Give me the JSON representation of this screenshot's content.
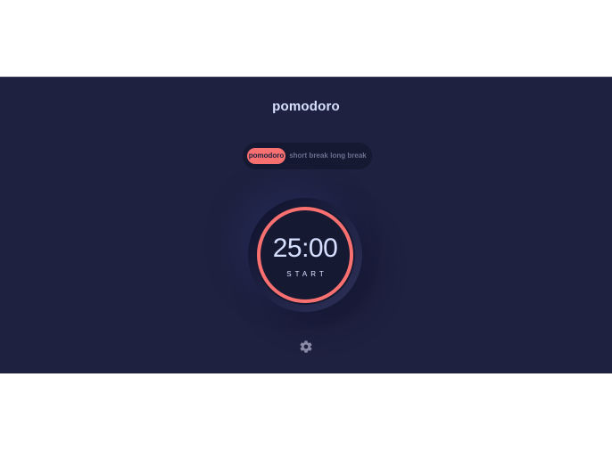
{
  "app": {
    "title": "pomodoro"
  },
  "modes": [
    {
      "label": "pomodoro",
      "active": true
    },
    {
      "label": "short break",
      "active": false
    },
    {
      "label": "long break",
      "active": false
    }
  ],
  "timer": {
    "time": "25:00",
    "action": "START",
    "progress": 1.0
  },
  "icons": {
    "settings": "gear-icon"
  },
  "colors": {
    "background": "#1e213f",
    "accent": "#f87070",
    "text": "#d7e0ff",
    "panel": "#161932"
  }
}
